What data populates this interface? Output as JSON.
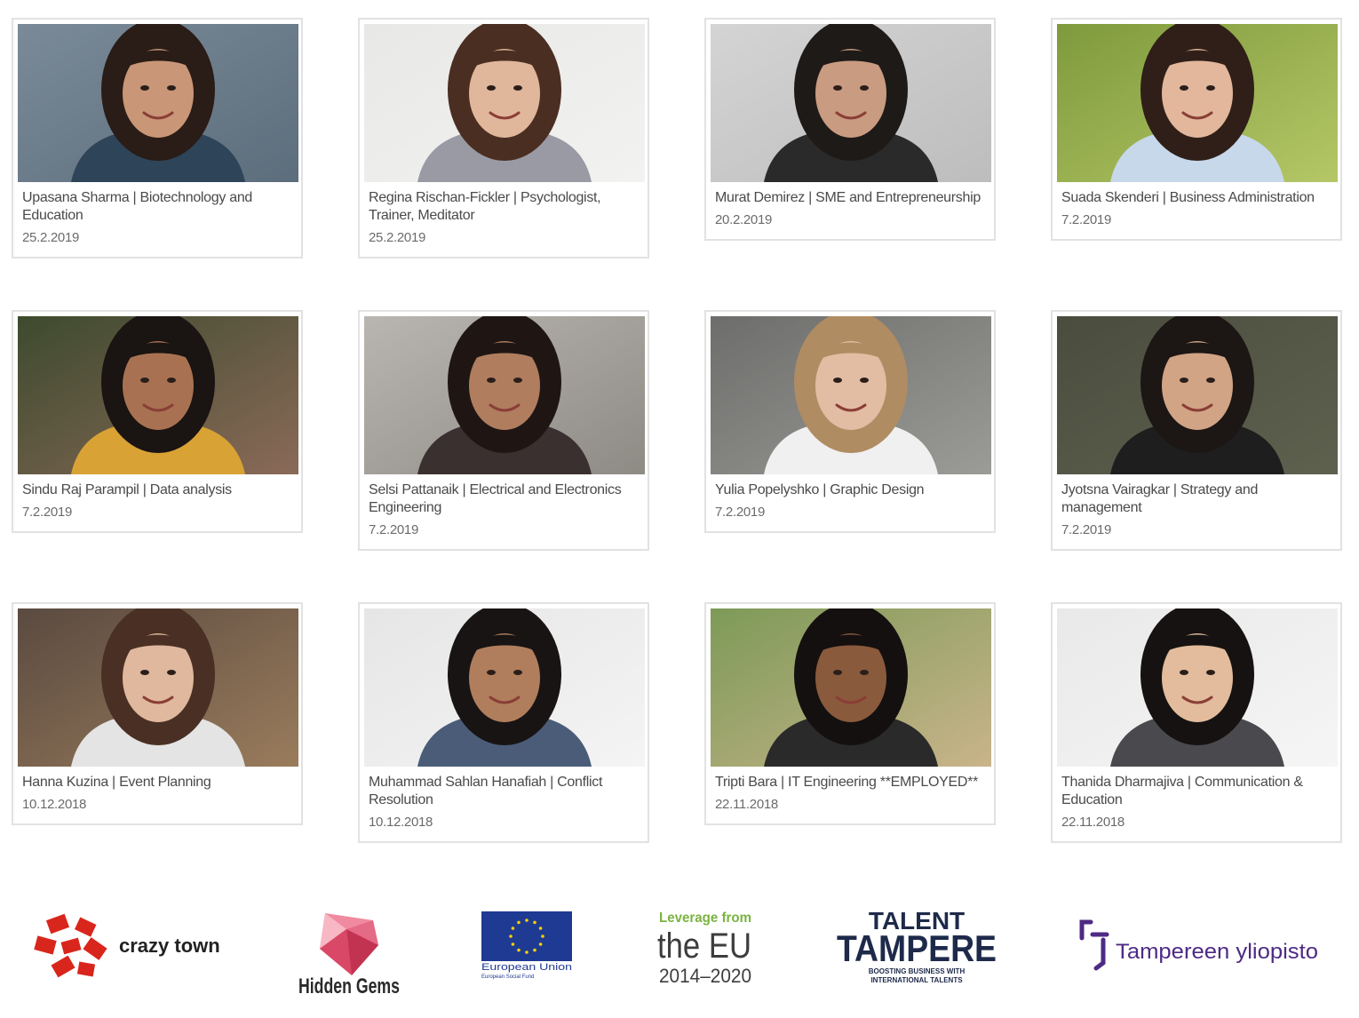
{
  "profiles": [
    {
      "name": "Upasana Sharma | Biotechnology and Education",
      "date": "25.2.2019",
      "photo": {
        "bg": "#7a8a98",
        "bg2": "#5c6d7c",
        "skin": "#c99677",
        "hair": "#2a1c16",
        "shirt": "#2e4458"
      }
    },
    {
      "name": "Regina Rischan-Fickler | Psychologist, Trainer, Meditator",
      "date": "25.2.2019",
      "photo": {
        "bg": "#e8e8e6",
        "bg2": "#f2f2f0",
        "skin": "#e0b79a",
        "hair": "#4a2e22",
        "shirt": "#9a9aa4"
      }
    },
    {
      "name": "Murat Demirez | SME and Entrepreneurship",
      "date": "20.2.2019",
      "photo": {
        "bg": "#d4d4d4",
        "bg2": "#bdbdbd",
        "skin": "#c99b80",
        "hair": "#1e1a18",
        "shirt": "#2a2a2a"
      }
    },
    {
      "name": "Suada Skenderi | Business Administration",
      "date": "7.2.2019",
      "photo": {
        "bg": "#7e9a3c",
        "bg2": "#b5c767",
        "skin": "#e2b79c",
        "hair": "#2f1f18",
        "shirt": "#c7d8ea"
      }
    },
    {
      "name": "Sindu Raj Parampil | Data analysis",
      "date": "7.2.2019",
      "photo": {
        "bg": "#3d4a2e",
        "bg2": "#8a6a58",
        "skin": "#a87252",
        "hair": "#1a1412",
        "shirt": "#d9a235"
      }
    },
    {
      "name": "Selsi Pattanaik | Electrical and Electronics Engineering",
      "date": "7.2.2019",
      "photo": {
        "bg": "#b9b5b0",
        "bg2": "#8e8a84",
        "skin": "#b07d5f",
        "hair": "#1f1614",
        "shirt": "#3a3030"
      }
    },
    {
      "name": "Yulia Popelyshko | Graphic Design",
      "date": "7.2.2019",
      "photo": {
        "bg": "#6d6d6b",
        "bg2": "#9b9b98",
        "skin": "#e3bca4",
        "hair": "#b08c62",
        "shirt": "#f0f0f0"
      }
    },
    {
      "name": "Jyotsna Vairagkar | Strategy and management",
      "date": "7.2.2019",
      "photo": {
        "bg": "#4a4c3e",
        "bg2": "#5f614f",
        "skin": "#d1a485",
        "hair": "#1c1614",
        "shirt": "#1e1e1e"
      }
    },
    {
      "name": "Hanna Kuzina | Event Planning",
      "date": "10.12.2018",
      "photo": {
        "bg": "#5a4a40",
        "bg2": "#9a7c5c",
        "skin": "#e0b89e",
        "hair": "#4a3024",
        "shirt": "#e4e4e4"
      }
    },
    {
      "name": "Muhammad Sahlan Hanafiah | Conflict Resolution",
      "date": "10.12.2018",
      "photo": {
        "bg": "#e6e6e6",
        "bg2": "#f4f4f4",
        "skin": "#b07e5c",
        "hair": "#181414",
        "shirt": "#4a5c78"
      }
    },
    {
      "name": "Tripti Bara | IT Engineering **EMPLOYED**",
      "date": "22.11.2018",
      "photo": {
        "bg": "#7d9a58",
        "bg2": "#c9b48a",
        "skin": "#8a5a3c",
        "hair": "#151010",
        "shirt": "#2a2a2a"
      }
    },
    {
      "name": "Thanida Dharmajiva | Communication & Education",
      "date": "22.11.2018",
      "photo": {
        "bg": "#e9e9e9",
        "bg2": "#f5f5f5",
        "skin": "#e2bc9c",
        "hair": "#161212",
        "shirt": "#4a4a4e"
      }
    }
  ],
  "sponsors": [
    {
      "name": "crazy town",
      "color": "#d9261c"
    },
    {
      "name": "Hidden Gems",
      "color": "#e05873"
    },
    {
      "name": "European Union",
      "sub": "European Social Fund",
      "color": "#1f3a93"
    },
    {
      "name": "Leverage from",
      "main": "the EU",
      "years": "2014–2020",
      "color": "#7bb342"
    },
    {
      "name": "TALENT",
      "main": "TAMPERE",
      "tag": "BOOSTING BUSINESS WITH",
      "tag2": "INTERNATIONAL TALENTS",
      "color": "#1e2a4a"
    },
    {
      "name": "Tampereen yliopisto",
      "color": "#4e2a84"
    }
  ]
}
